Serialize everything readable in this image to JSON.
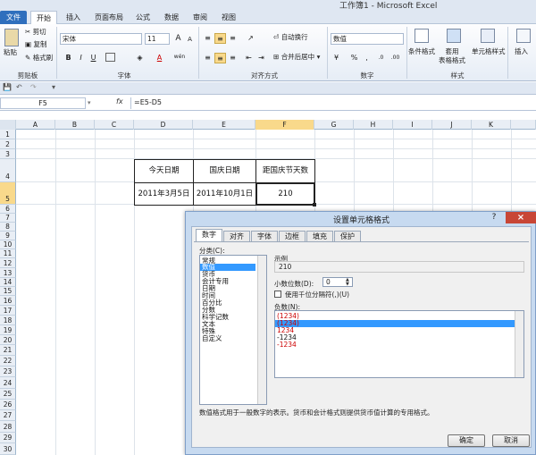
{
  "window": {
    "title": "工作簿1 - Microsoft Excel"
  },
  "tabs": [
    {
      "label": "文件"
    },
    {
      "label": "开始"
    },
    {
      "label": "插入"
    },
    {
      "label": "页面布局"
    },
    {
      "label": "公式"
    },
    {
      "label": "数据"
    },
    {
      "label": "审阅"
    },
    {
      "label": "视图"
    }
  ],
  "ribbon": {
    "clipboard": {
      "paste": "粘贴",
      "cut": "剪切",
      "copy": "复制",
      "format_painter": "格式刷",
      "label": "剪贴板"
    },
    "font": {
      "name": "宋体",
      "size": "11",
      "bold": "B",
      "italic": "I",
      "underline": "U",
      "grow": "A",
      "shrink": "A",
      "font_color": "A",
      "wen": "wén",
      "label": "字体"
    },
    "alignment": {
      "wrap": "自动换行",
      "merge": "合并后居中",
      "label": "对齐方式"
    },
    "number": {
      "format": "数值",
      "percent": "%",
      "comma": ",",
      "label": "数字"
    },
    "styles": {
      "conditional": "条件格式",
      "table": "套用\n表格格式",
      "cell": "单元格样式",
      "label": "样式"
    },
    "cells": {
      "insert": "插入"
    }
  },
  "formula_bar": {
    "name_box": "F5",
    "fx": "fx",
    "formula": "=E5-D5"
  },
  "grid": {
    "columns": [
      "A",
      "B",
      "C",
      "D",
      "E",
      "F",
      "G",
      "H",
      "I",
      "J",
      "K"
    ],
    "rows": [
      "1",
      "2",
      "3",
      "4",
      "5",
      "6",
      "7",
      "8",
      "9",
      "10",
      "11",
      "12",
      "13",
      "14",
      "15",
      "16",
      "17",
      "18",
      "19",
      "20",
      "21",
      "22",
      "23",
      "24",
      "25",
      "26",
      "27",
      "28",
      "29",
      "30"
    ],
    "selected_column": "F",
    "selected_row": "5",
    "table": {
      "headers": [
        "今天日期",
        "国庆日期",
        "距国庆节天数"
      ],
      "values": [
        "2011年3月5日",
        "2011年10月1日",
        "210"
      ]
    }
  },
  "dialog": {
    "title": "设置单元格格式",
    "help": "?",
    "close": "×",
    "tabs": [
      "数字",
      "对齐",
      "字体",
      "边框",
      "填充",
      "保护"
    ],
    "category_label": "分类(C):",
    "categories": [
      "常规",
      "数值",
      "货币",
      "会计专用",
      "日期",
      "时间",
      "百分比",
      "分数",
      "科学记数",
      "文本",
      "特殊",
      "自定义"
    ],
    "selected_category": "数值",
    "sample_label": "示例",
    "sample_value": "210",
    "decimals_label": "小数位数(D):",
    "decimals_value": "0",
    "thousands_label": "使用千位分隔符(,)(U)",
    "negative_label": "负数(N):",
    "negative_options": [
      "(1234)",
      "(1234)",
      "1234",
      "-1234",
      "-1234"
    ],
    "negative_selected_index": 1,
    "description": "数值格式用于一般数字的表示。货币和会计格式则提供货币值计算的专用格式。",
    "ok": "确定",
    "cancel": "取消"
  }
}
